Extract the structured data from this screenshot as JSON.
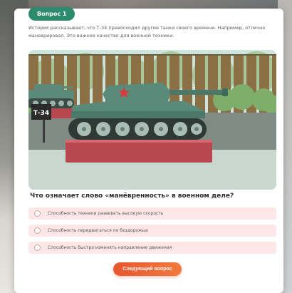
{
  "quiz": {
    "badge": "Вопрос 1",
    "intro": "История рассказывает, что Т-34 превосходил другие танки своего времени. Например, отлично маневрировал. Это важное качество для военной техники.",
    "question": "Что означает слово «манёвренность» в военном деле?",
    "options": [
      {
        "label": "Способность техники развивать высокую скорость"
      },
      {
        "label": "Способность передвигаться по бездорожью"
      },
      {
        "label": "Способность быстро изменять направление движения"
      }
    ],
    "next_label": "Следующий вопрос"
  },
  "scene": {
    "sign_label": "Т-34"
  },
  "colors": {
    "badge": "#2c8a6d",
    "option_bg": "#fce7e6",
    "button": "#e8562f",
    "tank": "#5a8a7a",
    "pedestal": "#b8474f"
  }
}
